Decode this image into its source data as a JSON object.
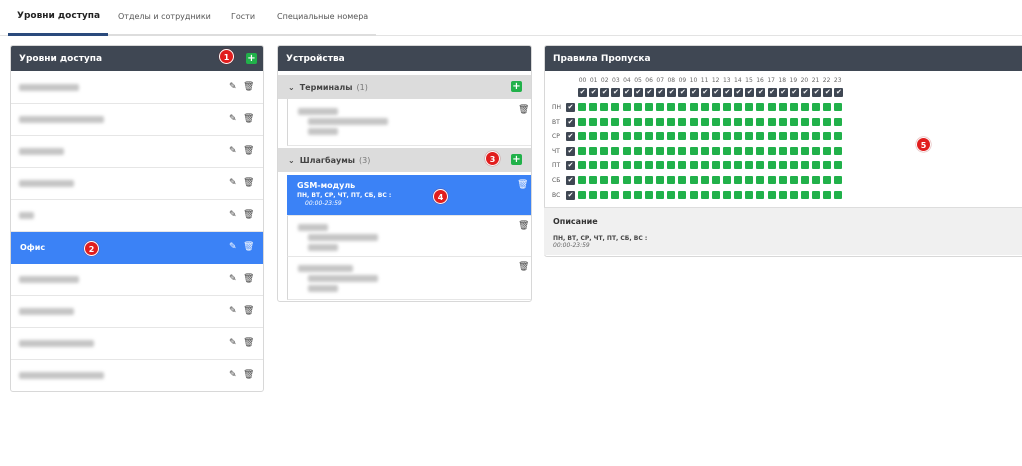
{
  "tabs": [
    {
      "label": "Уровни доступа",
      "active": true
    },
    {
      "label": "Отделы и сотрудники",
      "active": false
    },
    {
      "label": "Гости",
      "active": false
    },
    {
      "label": "Специальные номера",
      "active": false
    }
  ],
  "levels_panel": {
    "title": "Уровни доступа",
    "badge": "1",
    "items": [
      {
        "label": "",
        "selected": false
      },
      {
        "label": "",
        "selected": false
      },
      {
        "label": "",
        "selected": false
      },
      {
        "label": "",
        "selected": false
      },
      {
        "label": "",
        "selected": false
      },
      {
        "label": "Офис",
        "selected": true,
        "badge": "2"
      },
      {
        "label": "",
        "selected": false
      },
      {
        "label": "",
        "selected": false
      },
      {
        "label": "",
        "selected": false
      },
      {
        "label": "",
        "selected": false
      }
    ]
  },
  "devices_panel": {
    "title": "Устройства",
    "terminals": {
      "label": "Терминалы",
      "count": "(1)"
    },
    "barriers": {
      "label": "Шлагбаумы",
      "count": "(3)",
      "badge": "3"
    },
    "selected_device": {
      "name": "GSM-модуль",
      "days": "ПН, ВТ, СР, ЧТ, ПТ, СБ, ВС :",
      "time": "00:00-23:59",
      "badge": "4"
    }
  },
  "rules_panel": {
    "title": "Правила Пропуска",
    "badge": "5",
    "hours": [
      "00",
      "01",
      "02",
      "03",
      "04",
      "05",
      "06",
      "07",
      "08",
      "09",
      "10",
      "11",
      "12",
      "13",
      "14",
      "15",
      "16",
      "17",
      "18",
      "19",
      "20",
      "21",
      "22",
      "23"
    ],
    "days": [
      "ПН",
      "ВТ",
      "СР",
      "ЧТ",
      "ПТ",
      "СБ",
      "ВС"
    ],
    "description_title": "Описание",
    "description_days": "ПН, ВТ, СР, ЧТ, ПТ, СБ, ВС :",
    "description_time": "00:00-23:59"
  },
  "colors": {
    "header": "#3f4753",
    "selected": "#3b82f6",
    "green": "#21b14a",
    "badge": "#e11d1d"
  },
  "icons": {
    "add": "plus-icon",
    "edit": "edit-icon",
    "delete": "trash-icon",
    "expand": "chevron-down-icon",
    "check": "check-icon"
  }
}
